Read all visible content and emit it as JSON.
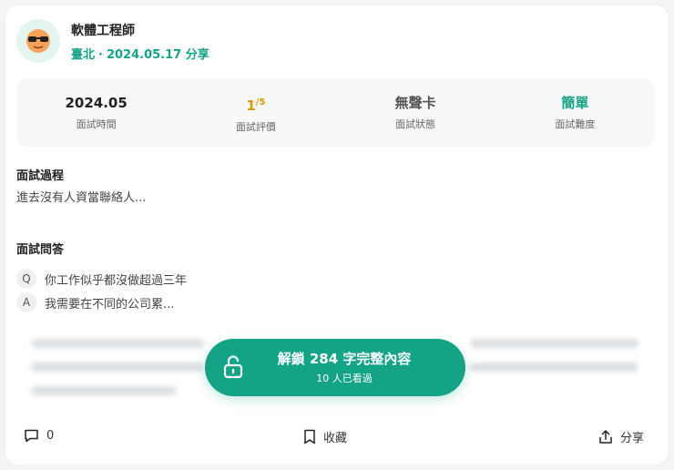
{
  "post": {
    "title": "軟體工程師",
    "location": "臺北",
    "date": "2024.05.17",
    "share_tag": "分享"
  },
  "stats": [
    {
      "value": "2024.05",
      "label": "面試時間"
    },
    {
      "value_main": "1",
      "value_denom": "/5",
      "label": "面試評價",
      "rating": 1,
      "rating_max": 5
    },
    {
      "value": "無聲卡",
      "label": "面試狀態"
    },
    {
      "value": "簡單",
      "label": "面試難度"
    }
  ],
  "process": {
    "title": "面試過程",
    "text": "進去沒有人資當聯絡人..."
  },
  "qa": {
    "title": "面試問答",
    "q_badge": "Q",
    "question": "你工作似乎都沒做超過三年",
    "a_badge": "A",
    "answer": "我需要在不同的公司累..."
  },
  "unlock": {
    "label": "解鎖 284 字完整內容",
    "sub": "10 人已看過"
  },
  "footer": {
    "comments_count": "0",
    "save_label": "收藏",
    "share_label": "分享"
  },
  "colors": {
    "accent": "#13a386",
    "rating": "#d99a00"
  }
}
